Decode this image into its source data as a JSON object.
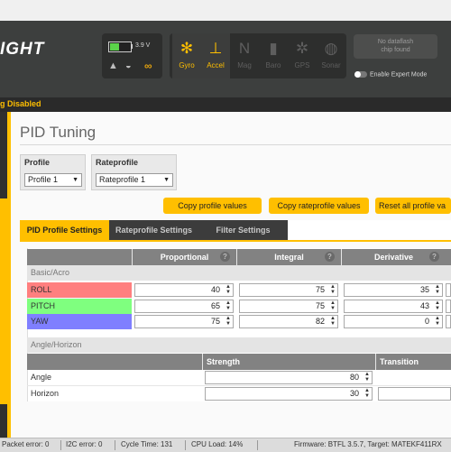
{
  "header": {
    "logo_text": "IGHT",
    "battery": {
      "voltage": "3.9 V",
      "level": 0.45,
      "color": "#5bd34a"
    },
    "icons": [
      "warning-icon",
      "parachute-icon",
      "link-icon"
    ],
    "sensors": [
      {
        "label": "Gyro",
        "glyph": "✻",
        "icon": "gyro-icon",
        "active": true
      },
      {
        "label": "Accel",
        "glyph": "⊥",
        "icon": "accel-icon",
        "active": true
      },
      {
        "label": "Mag",
        "glyph": "N",
        "icon": "mag-icon",
        "active": false
      },
      {
        "label": "Baro",
        "glyph": "▮",
        "icon": "baro-icon",
        "active": false
      },
      {
        "label": "GPS",
        "glyph": "✲",
        "icon": "gps-icon",
        "active": false
      },
      {
        "label": "Sonar",
        "glyph": "◍",
        "icon": "sonar-icon",
        "active": false
      }
    ],
    "dataflash_line1": "No dataflash",
    "dataflash_line2": "chip found",
    "expert_mode_label": "Enable Expert Mode",
    "accent_color": "#ffbf00"
  },
  "status_bar": {
    "text": "g Disabled"
  },
  "page": {
    "title": "PID Tuning",
    "profile": {
      "label": "Profile",
      "value": "Profile 1"
    },
    "rateprofile": {
      "label": "Rateprofile",
      "value": "Rateprofile 1"
    },
    "buttons": {
      "copy_profile": "Copy profile values",
      "copy_rateprofile": "Copy rateprofile values",
      "reset_all": "Reset all profile va"
    },
    "tabs": [
      "PID Profile Settings",
      "Rateprofile Settings",
      "Filter Settings"
    ],
    "pid_table": {
      "columns": [
        "Proportional",
        "Integral",
        "Derivative"
      ],
      "help_glyph": "?",
      "section": "Basic/Acro",
      "rows": [
        {
          "name": "ROLL",
          "color": "#ff7f7f",
          "values": [
            "40",
            "75",
            "35"
          ]
        },
        {
          "name": "PITCH",
          "color": "#7fff7f",
          "values": [
            "65",
            "75",
            "43"
          ]
        },
        {
          "name": "YAW",
          "color": "#7f7fff",
          "values": [
            "75",
            "82",
            "0"
          ]
        }
      ]
    },
    "angle_table": {
      "section": "Angle/Horizon",
      "columns": [
        "Strength",
        "Transition"
      ],
      "rows": [
        {
          "name": "Angle",
          "value": "80"
        },
        {
          "name": "Horizon",
          "value": "30"
        }
      ]
    }
  },
  "footer": {
    "packet_error": "Packet error: 0",
    "i2c_error": "I2C error: 0",
    "cycle_time": "Cycle Time: 131",
    "cpu_load": "CPU Load: 14%",
    "firmware": "Firmware: BTFL 3.5.7, Target: MATEKF411RX"
  }
}
